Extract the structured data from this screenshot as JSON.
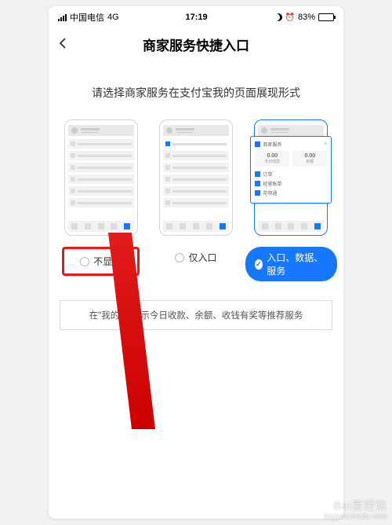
{
  "status_bar": {
    "carrier": "中国电信",
    "network": "4G",
    "time": "17:19",
    "battery_pct": "83%"
  },
  "nav": {
    "title": "商家服务快捷入口"
  },
  "subtitle": "请选择商家服务在支付宝我的页面展现形式",
  "options": {
    "opt1_label": "不显示",
    "opt2_label": "仅入口",
    "opt3_label": "入口、数据、服务"
  },
  "preview_card": {
    "title": "商家服务",
    "stat1_value": "0.00",
    "stat1_label": "今日收款",
    "stat2_value": "0.00",
    "stat2_label": "余额",
    "row1": "订单",
    "row2": "经营账单",
    "row3": "花呗通"
  },
  "info_text": "在\"我的\"中显示今日收款、余额、收钱有奖等推荐服务",
  "watermark": {
    "brand": "Bai度经验",
    "url": "jingyan.baidu.com"
  }
}
